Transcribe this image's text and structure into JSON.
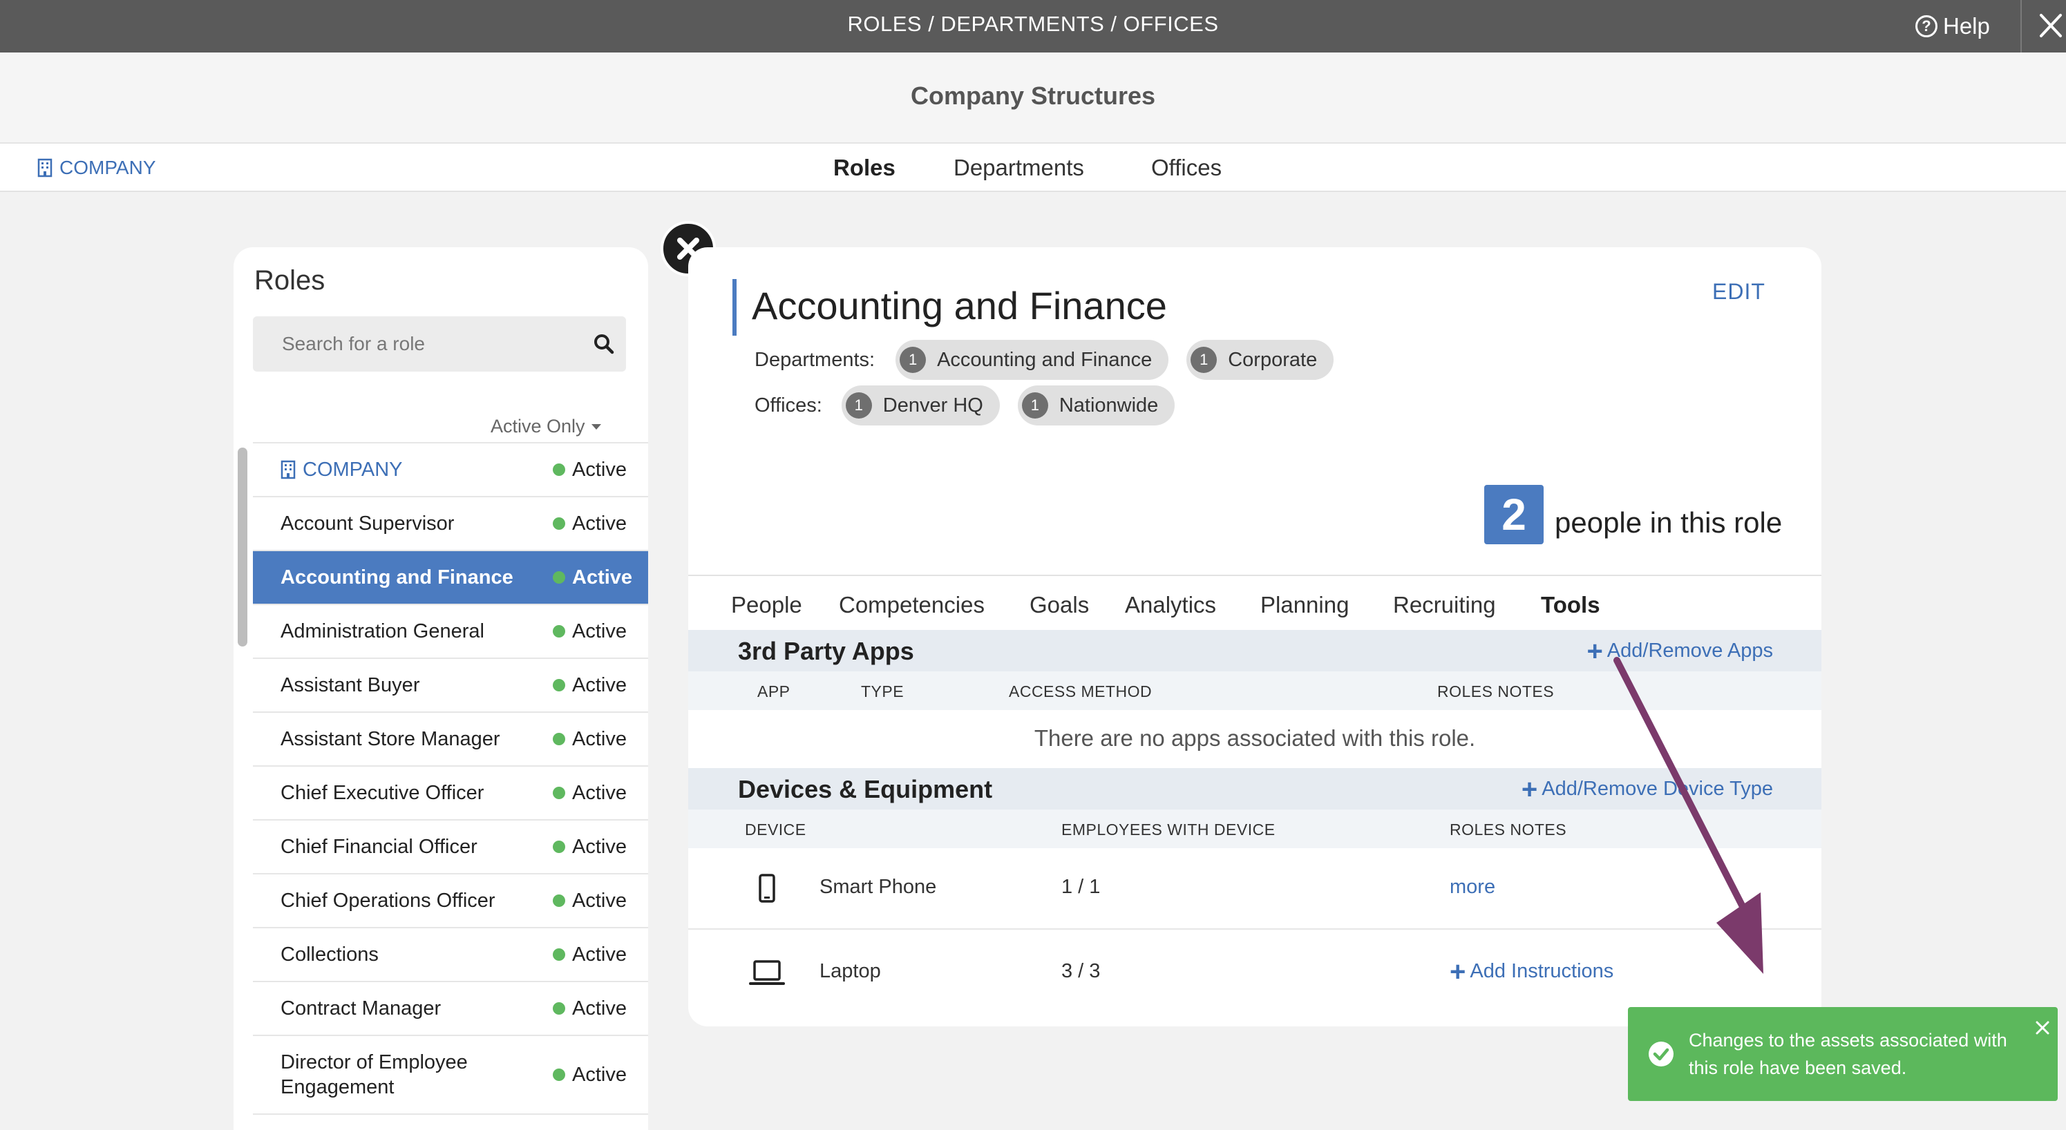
{
  "topbar": {
    "title": "ROLES / DEPARTMENTS / OFFICES",
    "help_label": "Help"
  },
  "header": {
    "title": "Company Structures"
  },
  "nav": {
    "company_label": "COMPANY",
    "tabs": [
      {
        "label": "Roles",
        "active": true
      },
      {
        "label": "Departments",
        "active": false
      },
      {
        "label": "Offices",
        "active": false
      }
    ]
  },
  "roles_panel": {
    "heading": "Roles",
    "search_placeholder": "Search for a role",
    "filter_label": "Active Only",
    "items": [
      {
        "name": "COMPANY",
        "status": "Active",
        "type": "company"
      },
      {
        "name": "Account Supervisor",
        "status": "Active"
      },
      {
        "name": "Accounting and Finance",
        "status": "Active",
        "selected": true
      },
      {
        "name": "Administration General",
        "status": "Active"
      },
      {
        "name": "Assistant Buyer",
        "status": "Active"
      },
      {
        "name": "Assistant Store Manager",
        "status": "Active"
      },
      {
        "name": "Chief Executive Officer",
        "status": "Active"
      },
      {
        "name": "Chief Financial Officer",
        "status": "Active"
      },
      {
        "name": "Chief Operations Officer",
        "status": "Active"
      },
      {
        "name": "Collections",
        "status": "Active"
      },
      {
        "name": "Contract Manager",
        "status": "Active"
      },
      {
        "name": "Director of Employee Engagement",
        "status": "Active"
      }
    ]
  },
  "role_detail": {
    "title": "Accounting and Finance",
    "edit_label": "EDIT",
    "departments_label": "Departments:",
    "departments": [
      {
        "count": "1",
        "name": "Accounting and Finance"
      },
      {
        "count": "1",
        "name": "Corporate"
      }
    ],
    "offices_label": "Offices:",
    "offices": [
      {
        "count": "1",
        "name": "Denver HQ"
      },
      {
        "count": "1",
        "name": "Nationwide"
      }
    ],
    "people_count": "2",
    "people_text": "people in this role",
    "tabs": [
      {
        "label": "People"
      },
      {
        "label": "Competencies"
      },
      {
        "label": "Goals"
      },
      {
        "label": "Analytics"
      },
      {
        "label": "Planning"
      },
      {
        "label": "Recruiting"
      },
      {
        "label": "Tools",
        "active": true
      }
    ],
    "apps_section": {
      "title": "3rd Party Apps",
      "action": "Add/Remove Apps",
      "columns": [
        "APP",
        "TYPE",
        "ACCESS METHOD",
        "ROLES NOTES"
      ],
      "empty_message": "There are no apps associated with this role."
    },
    "devices_section": {
      "title": "Devices & Equipment",
      "action": "Add/Remove Device Type",
      "columns": [
        "DEVICE",
        "EMPLOYEES WITH DEVICE",
        "ROLES NOTES"
      ],
      "rows": [
        {
          "icon": "smartphone-icon",
          "name": "Smart Phone",
          "count": "1 / 1",
          "note_link": "more"
        },
        {
          "icon": "laptop-icon",
          "name": "Laptop",
          "count": "3 / 3",
          "note_link": "Add Instructions"
        }
      ]
    }
  },
  "toast": {
    "message": "Changes to the assets associated with this role have been saved."
  },
  "colors": {
    "accent": "#4b7bc0",
    "link": "#3d6fb6",
    "success": "#5cb85c",
    "topbar": "#5a5a5a",
    "annotation": "#7b3a6b"
  }
}
